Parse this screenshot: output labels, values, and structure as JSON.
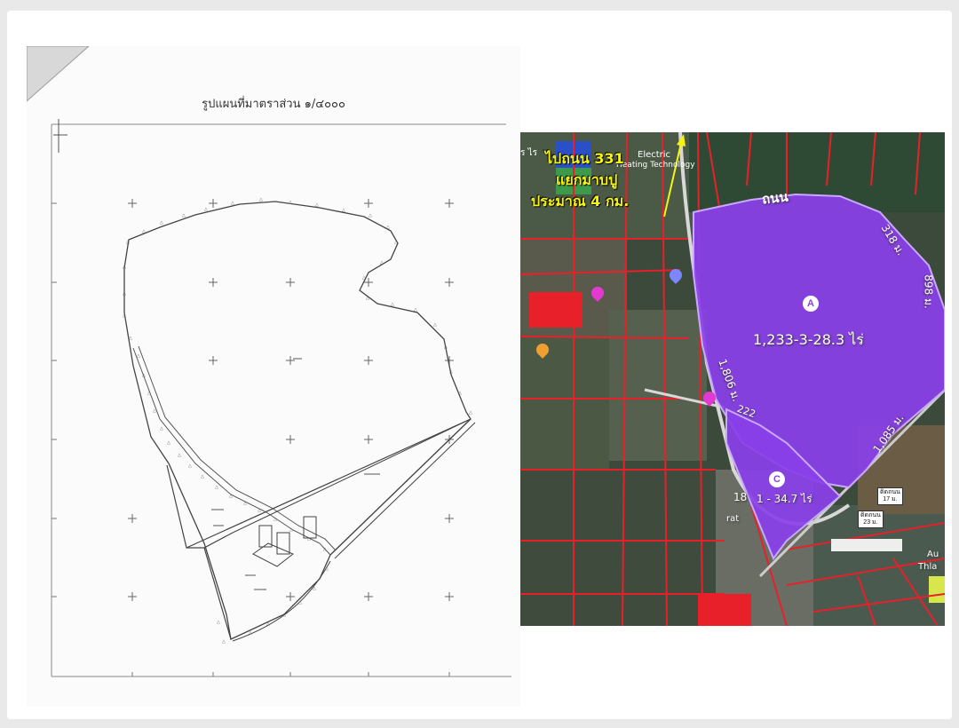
{
  "survey": {
    "title": "รูปแผนที่มาตราส่วน ๑/๔๐๐๐"
  },
  "aerial": {
    "direction_text": {
      "line1": "ไปถนน 331",
      "line2": "แยกมาบปู",
      "line3": "ประมาณ 4 กม."
    },
    "road_name": "ถนน",
    "parcel_a": {
      "marker": "A",
      "area": "1,233-3-28.3 ไร่"
    },
    "parcel_c": {
      "marker": "C",
      "area": "1 - 34.7 ไร่",
      "prefix": "18"
    },
    "dimensions": {
      "d318": "318 ม.",
      "d898": "898 ม.",
      "d1806": "1,806 ม.",
      "d1085": "1,085 ม.",
      "d222": "222"
    },
    "road_tags": {
      "tag1_line1": "ติดถนน",
      "tag1_line2": "17 ม.",
      "tag2_line1": "ติดถนน",
      "tag2_line2": "23 ม."
    },
    "partial_labels": {
      "electric": "Electric",
      "heating": "Heating Technology",
      "top_left": "ร ไร",
      "rate": "rat",
      "au": "Au",
      "thla": "Thla"
    },
    "colors": {
      "parcel": "#8a3fe8",
      "boundary": "#e8202a",
      "overlay_text": "#f7f313"
    }
  }
}
